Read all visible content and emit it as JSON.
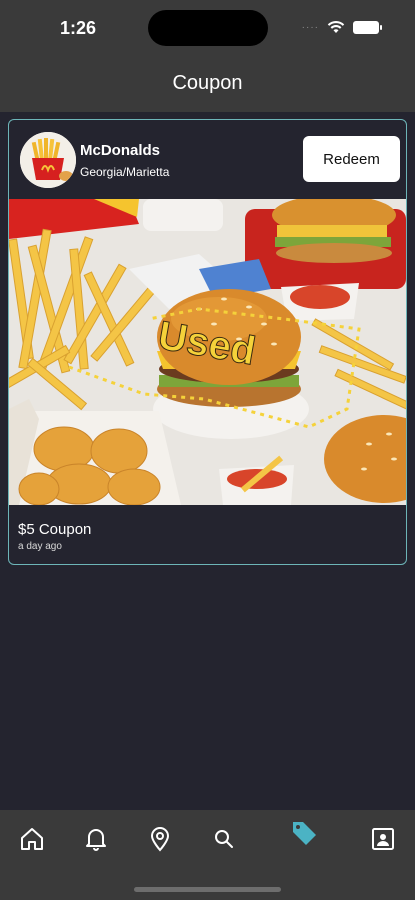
{
  "status_bar": {
    "time": "1:26",
    "signal": "····"
  },
  "header": {
    "title": "Coupon"
  },
  "coupon": {
    "merchant_name": "McDonalds",
    "location": "Georgia/Marietta",
    "redeem_label": "Redeem",
    "stamp_text": "Used",
    "title": "$5 Coupon",
    "time_ago": "a day ago"
  },
  "tabbar": {
    "items": [
      {
        "name": "home",
        "icon": "home-icon",
        "active": false
      },
      {
        "name": "notifications",
        "icon": "bell-icon",
        "active": false
      },
      {
        "name": "location",
        "icon": "location-pin-icon",
        "active": false
      },
      {
        "name": "search",
        "icon": "search-icon",
        "active": false
      },
      {
        "name": "coupons",
        "icon": "tag-icon",
        "active": true
      },
      {
        "name": "profile",
        "icon": "contact-card-icon",
        "active": false
      }
    ]
  },
  "colors": {
    "background": "#24242f",
    "bar": "#3a3a3a",
    "card_border": "#6db5b8",
    "active_tab": "#4bb3c4",
    "stamp": "#f5d23a"
  }
}
